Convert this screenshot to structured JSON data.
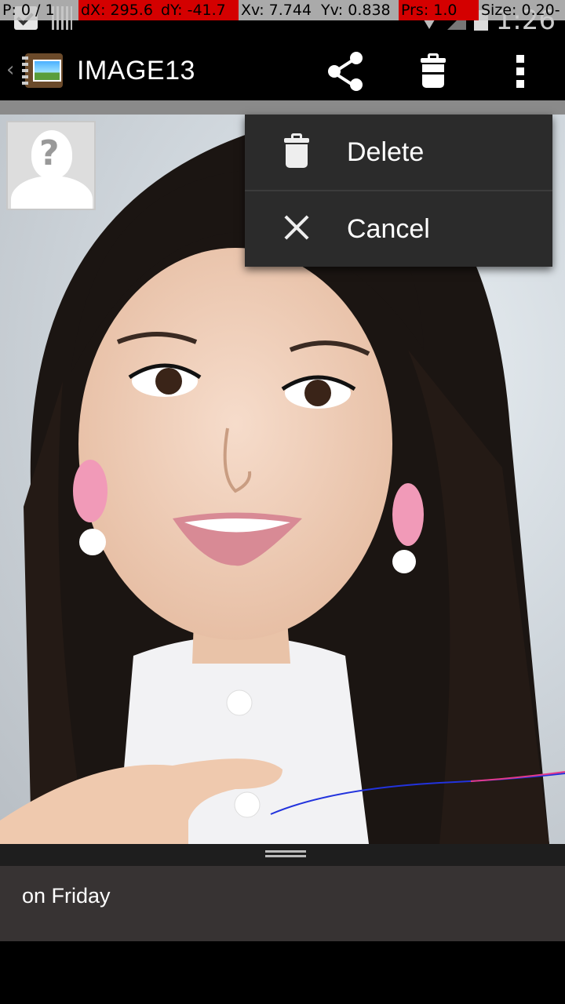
{
  "pointer_overlay": {
    "p": "P: 0 / 1",
    "dx": "dX: 295.6",
    "dy": "dY: -41.7",
    "xv": "Xv: 7.744",
    "yv": "Yv: 0.838",
    "prs": "Prs: 1.0",
    "size": "Size: 0.20-"
  },
  "status_bar": {
    "time": "1:26"
  },
  "action_bar": {
    "title": "IMAGE13",
    "share_icon": "share-icon",
    "delete_icon": "trash-icon",
    "overflow_icon": "overflow-menu-icon"
  },
  "contact_icon": "unknown-contact-icon",
  "popup_menu": {
    "items": [
      {
        "label": "Delete",
        "icon": "trash-icon"
      },
      {
        "label": "Cancel",
        "icon": "close-icon"
      }
    ]
  },
  "caption": {
    "text": "on Friday"
  },
  "colors": {
    "menu_bg": "#2b2b2b",
    "overlay_red": "#d40000",
    "overlay_gray": "#c8c8c8"
  }
}
